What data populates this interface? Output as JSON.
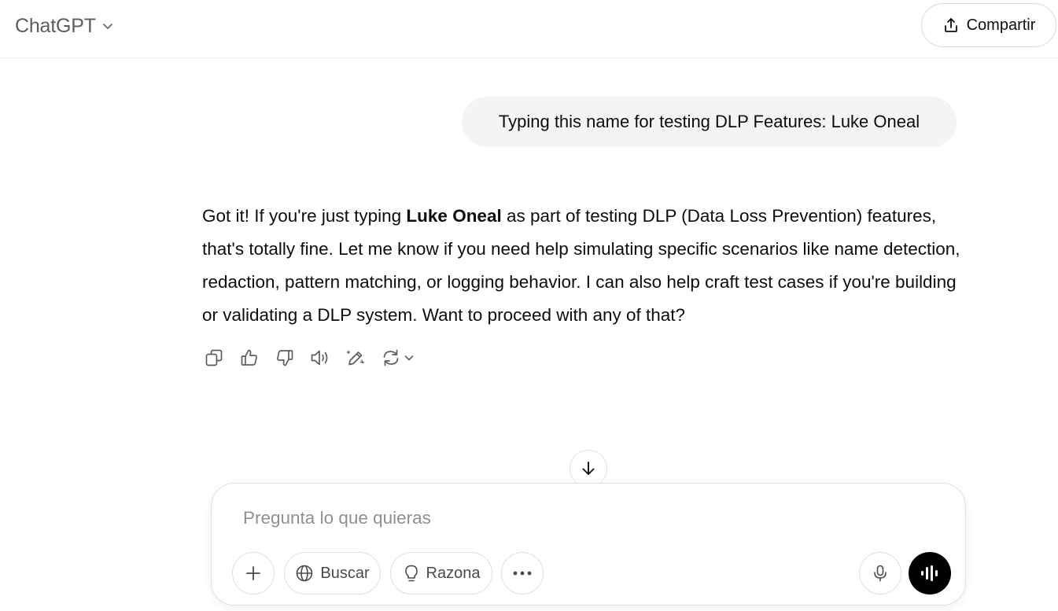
{
  "header": {
    "model_name": "ChatGPT",
    "share_label": "Compartir"
  },
  "conversation": {
    "user_message": "Typing this name for testing DLP Features: Luke Oneal",
    "assistant_message": {
      "before_bold": "Got it! If you're just typing ",
      "bold": "Luke Oneal",
      "after_bold": " as part of testing DLP (Data Loss Prevention) features, that's totally fine. Let me know if you need help simulating specific scenarios like name detection, redaction, pattern matching, or logging behavior. I can also help craft test cases if you're building or validating a DLP system. Want to proceed with any of that?"
    },
    "action_icons": [
      "copy-icon",
      "thumbs-up-icon",
      "thumbs-down-icon",
      "read-aloud-icon",
      "edit-canvas-icon",
      "regenerate-icon"
    ]
  },
  "composer": {
    "placeholder": "Pregunta lo que quieras",
    "search_label": "Buscar",
    "reason_label": "Razona"
  },
  "colors": {
    "user_bubble_bg": "#f4f4f4",
    "voice_button_bg": "#000000",
    "placeholder": "#8f8f8f"
  }
}
